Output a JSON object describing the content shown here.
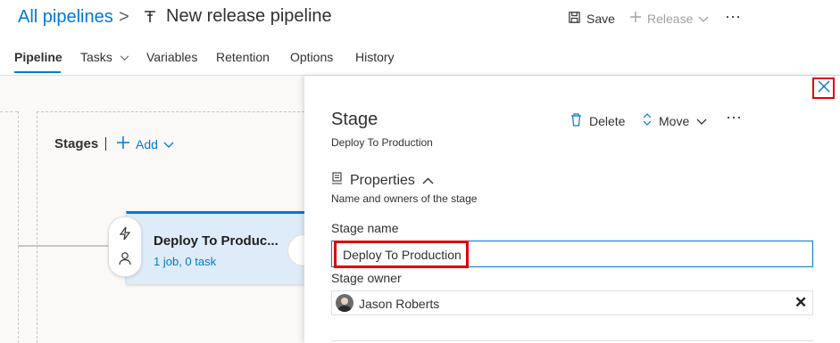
{
  "header": {
    "breadcrumb_link": "All pipelines",
    "breadcrumb_sep": ">",
    "pipeline_icon": "pipeline-icon",
    "title": "New release pipeline",
    "save_label": "Save",
    "release_label": "Release",
    "more_label": "···"
  },
  "tabs": [
    {
      "label": "Pipeline",
      "active": true
    },
    {
      "label": "Tasks"
    },
    {
      "label": "Variables"
    },
    {
      "label": "Retention"
    },
    {
      "label": "Options"
    },
    {
      "label": "History"
    }
  ],
  "canvas": {
    "stages_label": "Stages",
    "add_label": "Add",
    "stage_card": {
      "name": "Deploy To Produc...",
      "subtitle": "1 job, 0 task"
    }
  },
  "panel": {
    "title": "Stage",
    "subtitle": "Deploy To Production",
    "delete_label": "Delete",
    "move_label": "Move",
    "more_label": "···",
    "properties": {
      "heading": "Properties",
      "subheading": "Name and owners of the stage"
    },
    "stage_name_label": "Stage name",
    "stage_name_value": "Deploy To Production",
    "stage_owner_label": "Stage owner",
    "stage_owner_value": "Jason Roberts"
  },
  "colors": {
    "accent": "#0078d4",
    "highlight": "#e00000",
    "card_bg": "#deecf9"
  }
}
